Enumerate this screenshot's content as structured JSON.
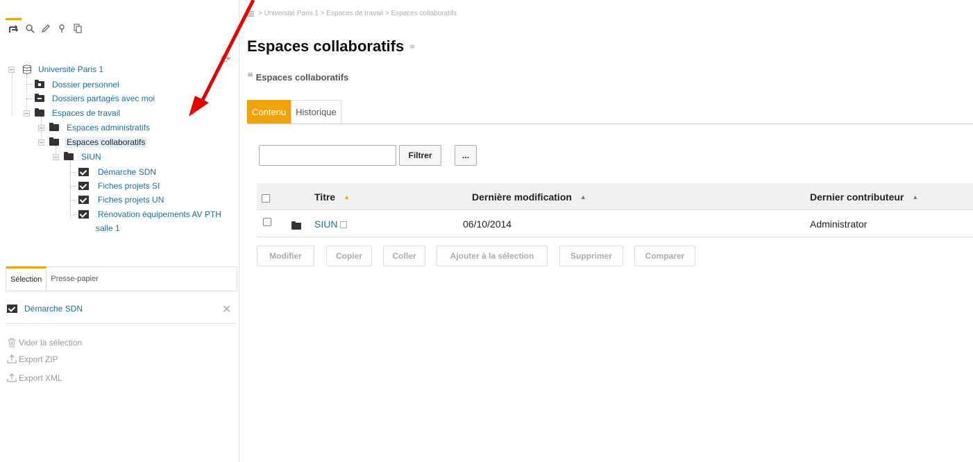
{
  "left_panel": {
    "toolbar": [
      "tree-icon",
      "search-icon",
      "pencil-icon",
      "pin-icon",
      "copy-icon"
    ],
    "tree": {
      "root": "Université Paris 1",
      "dossier_personnel": "Dossier personnel",
      "dossiers_partages": "Dossiers partagés avec moi",
      "espaces_travail": "Espaces de travail",
      "espaces_admin": "Espaces administratifs",
      "espaces_collab": "Espaces collaboratifs",
      "siun": "SIUN",
      "demarche_sdn": "Démarche SDN",
      "fiches_si": "Fiches projets SI",
      "fiches_un": "Fiches projets UN",
      "renovation_line1": "Rénovation équipements AV PTH",
      "renovation_line2": "salle 1"
    },
    "tabs": {
      "selection": "Sélection",
      "clipboard": "Presse-papier"
    },
    "selection_item": "Démarche SDN",
    "actions": {
      "vider": "Vider la sélection",
      "export_zip": "Export ZIP",
      "export_xml": "Export XML"
    }
  },
  "main": {
    "breadcrumb": "> Université Paris 1 > Espaces de travail > Espaces collaboratifs",
    "title": "Espaces collaboratifs",
    "subtitle": "Espaces collaboratifs",
    "tabs": {
      "contenu": "Contenu",
      "historique": "Historique"
    },
    "filter": {
      "value": "",
      "button": "Filtrer",
      "more": "..."
    },
    "table": {
      "headers": {
        "titre": "Titre",
        "modif": "Dernière modification",
        "contrib": "Dernier contributeur"
      },
      "rows": [
        {
          "titre": "SIUN",
          "modif": "06/10/2014",
          "contrib": "Administrator"
        }
      ]
    },
    "actions": {
      "modifier": "Modifier",
      "copier": "Copier",
      "coller": "Coller",
      "ajouter": "Ajouter à la sélection",
      "supprimer": "Supprimer",
      "comparer": "Comparer"
    }
  },
  "colors": {
    "accent": "#f0a30a",
    "link": "#1a6ea0",
    "annotation_arrow": "#e60000"
  }
}
